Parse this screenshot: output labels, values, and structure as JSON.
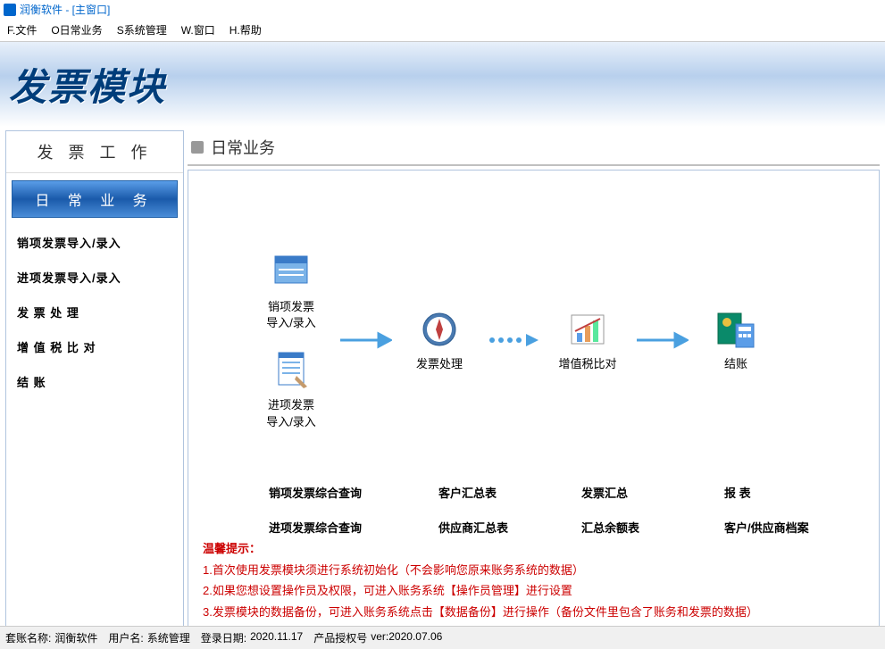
{
  "titlebar": {
    "text": "润衡软件 - [主窗口]"
  },
  "menubar": {
    "file": "F.文件",
    "daily": "O日常业务",
    "system": "S系统管理",
    "window": "W.窗口",
    "help": "H.帮助"
  },
  "banner": {
    "title": "发票模块"
  },
  "sidebar": {
    "header": "发 票 工 作",
    "active": "日 常 业 务",
    "items": [
      "销项发票导入/录入",
      "进项发票导入/录入",
      "发 票 处 理",
      "增 值 税 比 对",
      "结       账"
    ]
  },
  "main": {
    "header": "日常业务",
    "flow": {
      "node1a": "销项发票\n导入/录入",
      "node1b": "进项发票\n导入/录入",
      "node2": "发票处理",
      "node3": "增值税比对",
      "node4": "结账"
    },
    "links": {
      "col1": [
        "销项发票综合查询",
        "进项发票综合查询"
      ],
      "col2": [
        "客户汇总表",
        "供应商汇总表"
      ],
      "col3": [
        "发票汇总",
        "汇总余额表"
      ],
      "col4": [
        "报    表",
        "客户/供应商档案"
      ]
    },
    "tips": {
      "title": "温馨提示：",
      "lines": [
        "1.首次使用发票模块须进行系统初始化（不会影响您原来账务系统的数据）",
        "2.如果您想设置操作员及权限，可进入账务系统【操作员管理】进行设置",
        "3.发票模块的数据备份，可进入账务系统点击【数据备份】进行操作（备份文件里包含了账务和发票的数据）"
      ]
    }
  },
  "statusbar": {
    "account_label": "套账名称:",
    "account": "润衡软件",
    "user_label": "用户名:",
    "user": "系统管理",
    "date_label": "登录日期:",
    "date": "2020.11.17",
    "license_label": "产品授权号",
    "license": "ver:2020.07.06"
  }
}
